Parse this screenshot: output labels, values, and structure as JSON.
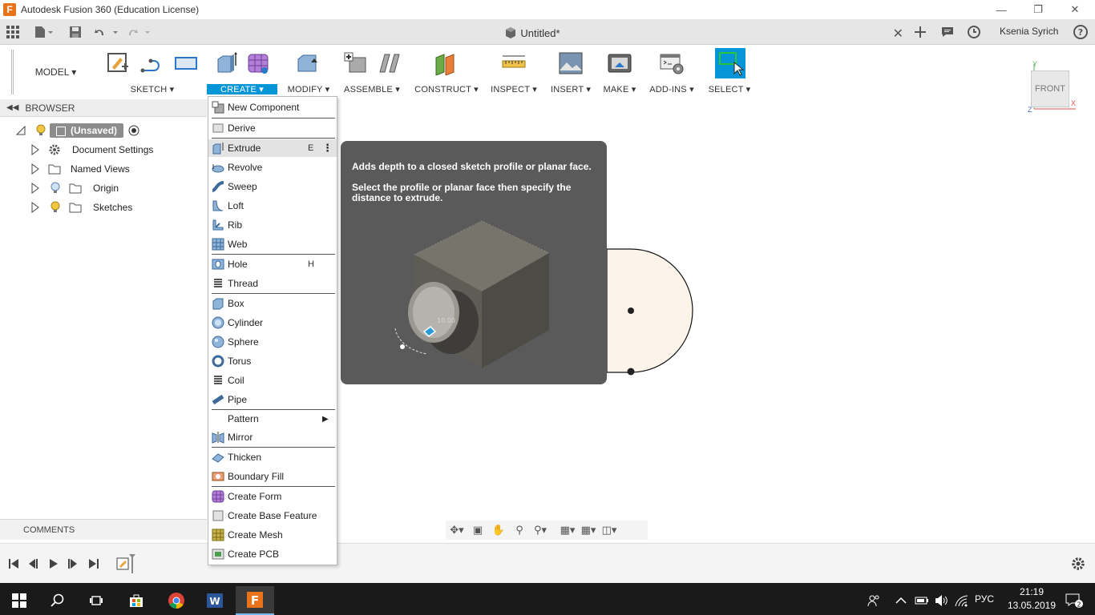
{
  "window": {
    "title": "Autodesk Fusion 360 (Education License)",
    "app_icon_letter": "F"
  },
  "tab": {
    "document_title": "Untitled*"
  },
  "user": {
    "name": "Ksenia Syrich"
  },
  "toolbar": {
    "workspace": "MODEL ▾",
    "groups": [
      {
        "label": "SKETCH ▾"
      },
      {
        "label": "CREATE ▾"
      },
      {
        "label": "MODIFY ▾"
      },
      {
        "label": "ASSEMBLE ▾"
      },
      {
        "label": "CONSTRUCT ▾"
      },
      {
        "label": "INSPECT ▾"
      },
      {
        "label": "INSERT ▾"
      },
      {
        "label": "MAKE ▾"
      },
      {
        "label": "ADD-INS ▾"
      },
      {
        "label": "SELECT ▾"
      }
    ]
  },
  "viewcube": {
    "face": "FRONT",
    "axis_y": "Y",
    "axis_x": "X",
    "axis_z": "Z"
  },
  "browser": {
    "title": "BROWSER",
    "root_label": "(Unsaved)",
    "items": [
      {
        "label": "Document Settings"
      },
      {
        "label": "Named Views"
      },
      {
        "label": "Origin"
      },
      {
        "label": "Sketches"
      }
    ]
  },
  "comments": {
    "title": "COMMENTS"
  },
  "create_menu": {
    "items": [
      {
        "label": "New Component"
      },
      {
        "label": "Derive"
      },
      {
        "label": "Extrude",
        "shortcut": "E"
      },
      {
        "label": "Revolve"
      },
      {
        "label": "Sweep"
      },
      {
        "label": "Loft"
      },
      {
        "label": "Rib"
      },
      {
        "label": "Web"
      },
      {
        "label": "Hole",
        "shortcut": "H"
      },
      {
        "label": "Thread"
      },
      {
        "label": "Box"
      },
      {
        "label": "Cylinder"
      },
      {
        "label": "Sphere"
      },
      {
        "label": "Torus"
      },
      {
        "label": "Coil"
      },
      {
        "label": "Pipe"
      },
      {
        "label": "Pattern"
      },
      {
        "label": "Mirror"
      },
      {
        "label": "Thicken"
      },
      {
        "label": "Boundary Fill"
      },
      {
        "label": "Create Form"
      },
      {
        "label": "Create Base Feature"
      },
      {
        "label": "Create Mesh"
      },
      {
        "label": "Create PCB"
      }
    ]
  },
  "tooltip": {
    "line1": "Adds depth to a closed sketch profile or planar face.",
    "line2": "Select the profile or planar face then specify the distance to extrude.",
    "dim_value": "10.00"
  },
  "taskbar": {
    "language": "РУС",
    "time": "21:19",
    "date": "13.05.2019",
    "notification_count": "2"
  },
  "colors": {
    "accent": "#0696d7",
    "tooltip_bg": "#5a5a5a",
    "brand_orange": "#e8731a"
  }
}
